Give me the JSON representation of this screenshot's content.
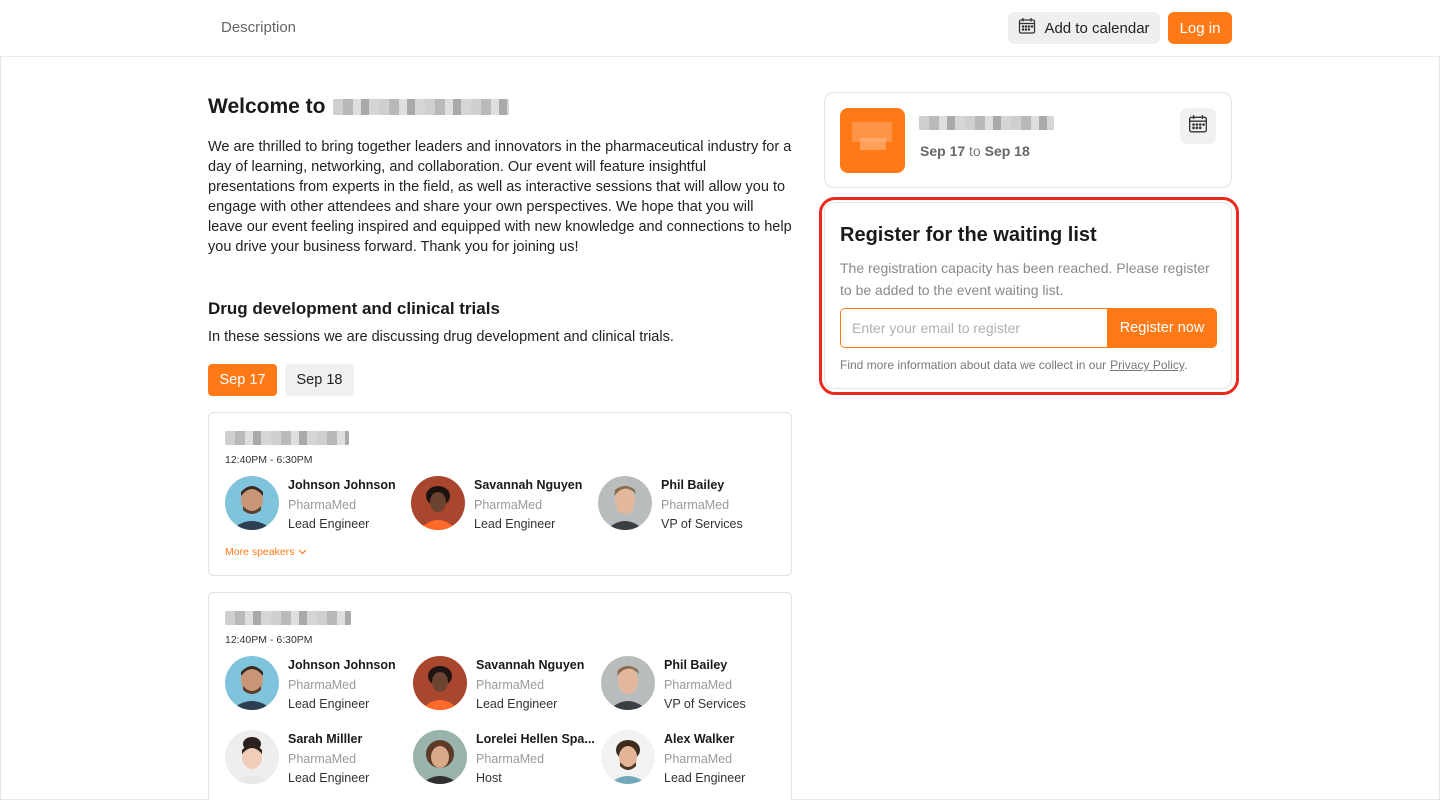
{
  "header": {
    "nav_description": "Description",
    "add_to_calendar": "Add to calendar",
    "login": "Log in",
    "icons": [
      "calendar-icon"
    ]
  },
  "welcome": {
    "title_prefix": "Welcome to",
    "intro": "We are thrilled to bring together leaders and innovators in the pharmaceutical industry for a day of learning, networking, and collaboration. Our event will feature insightful presentations from experts in the field, as well as interactive sessions that will allow you to engage with other attendees and share your own perspectives. We hope that you will leave our event feeling inspired and equipped with new knowledge and connections to help you drive your business forward. Thank you for joining us!"
  },
  "section": {
    "title": "Drug development and clinical trials",
    "description": "In these sessions we are discussing drug development and clinical trials.",
    "days": [
      "Sep 17",
      "Sep 18"
    ],
    "active_day": "Sep 17"
  },
  "sessions": [
    {
      "time": "12:40PM - 6:30PM",
      "more_speakers": "More speakers",
      "speakers": [
        {
          "name": "Johnson Johnson",
          "org": "PharmaMed",
          "role": "Lead Engineer"
        },
        {
          "name": "Savannah Nguyen",
          "org": "PharmaMed",
          "role": "Lead Engineer"
        },
        {
          "name": "Phil Bailey",
          "org": "PharmaMed",
          "role": "VP of Services"
        }
      ]
    },
    {
      "time": "12:40PM - 6:30PM",
      "speakers": [
        {
          "name": "Johnson Johnson",
          "org": "PharmaMed",
          "role": "Lead Engineer"
        },
        {
          "name": "Savannah Nguyen",
          "org": "PharmaMed",
          "role": "Lead Engineer"
        },
        {
          "name": "Phil Bailey",
          "org": "PharmaMed",
          "role": "VP of Services"
        },
        {
          "name": "Sarah Milller",
          "org": "PharmaMed",
          "role": "Lead Engineer"
        },
        {
          "name": "Lorelei Hellen Spa...",
          "org": "PharmaMed",
          "role": "Host"
        },
        {
          "name": "Alex Walker",
          "org": "PharmaMed",
          "role": "Lead Engineer"
        }
      ]
    }
  ],
  "event": {
    "date_start": "Sep 17",
    "date_to": "to",
    "date_end": "Sep 18"
  },
  "register": {
    "title": "Register for the waiting list",
    "description": "The registration capacity has been reached. Please register to be added to the event waiting list.",
    "email_placeholder": "Enter your email to register",
    "email_value": "",
    "button": "Register now",
    "privacy_text": "Find more information about data we collect in our",
    "privacy_link": "Privacy Policy",
    "privacy_end": "."
  },
  "colors": {
    "accent": "#ff7a17",
    "highlight": "#ec2a1b"
  }
}
